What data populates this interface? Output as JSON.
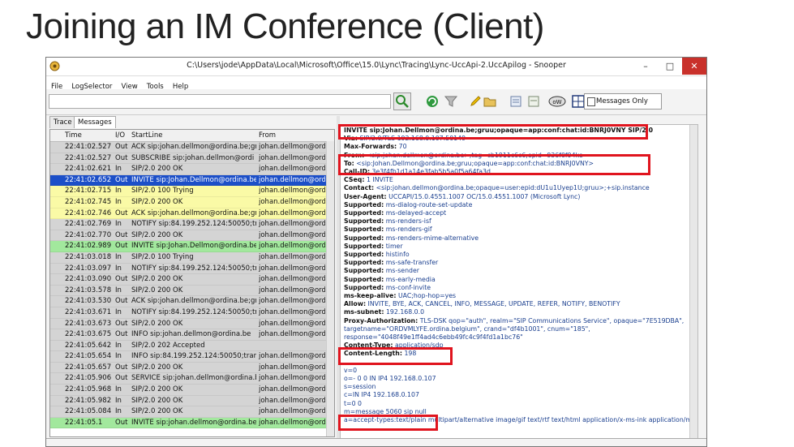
{
  "slide": {
    "title": "Joining an IM Conference (Client)"
  },
  "window": {
    "title": "C:\\Users\\jode\\AppData\\Local\\Microsoft\\Office\\15.0\\Lync\\Tracing\\Lync-UccApi-2.UccApilog - Snooper",
    "minimize": "–",
    "maximize": "□",
    "close": "✕"
  },
  "menu": [
    "File",
    "LogSelector",
    "View",
    "Tools",
    "Help"
  ],
  "toolbar": {
    "filter_value": "",
    "messages_only_label": "Messages Only",
    "messages_only_checked": false
  },
  "tabs": [
    "Trace",
    "Messages"
  ],
  "grid": {
    "columns": [
      "Time",
      "I/O",
      "StartLine",
      "From"
    ],
    "rows": [
      {
        "time": "22:41:02.527",
        "io": "Out",
        "start": "ACK sip:johan.dellmon@ordina.be;gr",
        "from": "johan.dellmon@ordi",
        "style": "gray"
      },
      {
        "time": "22:41:02.527",
        "io": "Out",
        "start": "SUBSCRIBE sip:johan.dellmon@ordi",
        "from": "johan.dellmon@ordi",
        "style": "gray"
      },
      {
        "time": "22:41:02.621",
        "io": "In",
        "start": "SIP/2.0 200 OK",
        "from": "johan.dellmon@ordi",
        "style": "gray"
      },
      {
        "time": "22:41:02.652",
        "io": "Out",
        "start": "INVITE sip:Johan.Dellmon@ordina.be;g",
        "from": "johan.dellmon@ordi",
        "style": "selected"
      },
      {
        "time": "22:41:02.715",
        "io": "In",
        "start": "SIP/2.0 100 Trying",
        "from": "johan.dellmon@ordi",
        "style": "yellow"
      },
      {
        "time": "22:41:02.745",
        "io": "In",
        "start": "SIP/2.0 200 OK",
        "from": "johan.dellmon@ordi",
        "style": "yellow"
      },
      {
        "time": "22:41:02.746",
        "io": "Out",
        "start": "ACK sip:johan.dellmon@ordina.be;gr",
        "from": "johan.dellmon@ordi",
        "style": "yellow"
      },
      {
        "time": "22:41:02.769",
        "io": "In",
        "start": "NOTIFY sip:84.199.252.124:50050;tran",
        "from": "johan.dellmon@ordi",
        "style": "gray"
      },
      {
        "time": "22:41:02.770",
        "io": "Out",
        "start": "SIP/2.0 200 OK",
        "from": "johan.dellmon@ordi",
        "style": "gray"
      },
      {
        "time": "22:41:02.989",
        "io": "Out",
        "start": "INVITE sip:Johan.Dellmon@ordina.be;",
        "from": "johan.dellmon@ordi",
        "style": "green"
      },
      {
        "time": "22:41:03.018",
        "io": "In",
        "start": "SIP/2.0 100 Trying",
        "from": "johan.dellmon@ordi",
        "style": "gray"
      },
      {
        "time": "22:41:03.097",
        "io": "In",
        "start": "NOTIFY sip:84.199.252.124:50050;tran",
        "from": "johan.dellmon@ordi",
        "style": "gray"
      },
      {
        "time": "22:41:03.090",
        "io": "Out",
        "start": "SIP/2.0 200 OK",
        "from": "johan.dellmon@ordi",
        "style": "gray"
      },
      {
        "time": "22:41:03.578",
        "io": "In",
        "start": "SIP/2.0 200 OK",
        "from": "johan.dellmon@ordi",
        "style": "gray"
      },
      {
        "time": "22:41:03.530",
        "io": "Out",
        "start": "ACK sip:johan.dellmon@ordina.be;gr",
        "from": "johan.dellmon@ordi",
        "style": "gray"
      },
      {
        "time": "22:41:03.671",
        "io": "In",
        "start": "NOTIFY sip:84.199.252.124:50050;tran",
        "from": "johan.dellmon@ordi",
        "style": "gray"
      },
      {
        "time": "22:41:03.673",
        "io": "Out",
        "start": "SIP/2.0 200 OK",
        "from": "johan.dellmon@ordi",
        "style": "gray"
      },
      {
        "time": "22:41:03.675",
        "io": "Out",
        "start": "INFO sip:johan.dellmon@ordina.be",
        "from": "johan.dellmon@ordi",
        "style": "gray"
      },
      {
        "time": "22:41:05.642",
        "io": "In",
        "start": "SIP/2.0 202 Accepted",
        "from": "",
        "style": "gray"
      },
      {
        "time": "22:41:05.654",
        "io": "In",
        "start": "INFO sip:84.199.252.124:50050;transpo",
        "from": "johan.dellmon@ordi",
        "style": "gray"
      },
      {
        "time": "22:41:05.657",
        "io": "Out",
        "start": "SIP/2.0 200 OK",
        "from": "johan.dellmon@ordi",
        "style": "gray"
      },
      {
        "time": "22:41:05.906",
        "io": "Out",
        "start": "SERVICE sip:johan.dellmon@ordina.be",
        "from": "johan.dellmon@ordi",
        "style": "gray"
      },
      {
        "time": "22:41:05.968",
        "io": "In",
        "start": "SIP/2.0 200 OK",
        "from": "johan.dellmon@ordi",
        "style": "gray"
      },
      {
        "time": "22:41:05.982",
        "io": "In",
        "start": "SIP/2.0 200 OK",
        "from": "johan.dellmon@ordi",
        "style": "gray"
      },
      {
        "time": "22:41:05.084",
        "io": "In",
        "start": "SIP/2.0 200 OK",
        "from": "johan.dellmon@ordi",
        "style": "gray"
      },
      {
        "time": "22:41:05.1",
        "io": "Out",
        "start": "INVITE sip:johan.dellmon@ordina.be",
        "from": "johan.dellmon@ordi",
        "style": "green"
      }
    ]
  },
  "detail": {
    "lines": [
      {
        "k": "INVITE sip:Johan.Dellmon@ordina.be;gruu;opaque=app:conf:chat:id:BNRJ0VNY SIP/2.0",
        "v": ""
      },
      {
        "k": "Via:",
        "v": "SIP/2.0/TLS 192.168.0.107:50149"
      },
      {
        "k": "Max-Forwards:",
        "v": "70"
      },
      {
        "k": "From:",
        "v": "<sip:johan.dellmon@ordina.be>;tag=cb1911c6c6;epid=936f0f94ke"
      },
      {
        "k": "To:",
        "v": "<sip:Johan.Dellmon@ordina.be;gruu;opaque=app:conf:chat:id:BNRJ0VNY>"
      },
      {
        "k": "Call-ID:",
        "v": "3e3f4fb1d1a14e3fab5b5a0f5a64fa3d"
      },
      {
        "k": "CSeq:",
        "v": "1 INVITE"
      },
      {
        "k": "Contact:",
        "v": "<sip:johan.dellmon@ordina.be;opaque=user:epid:dU1u1Uyep1U;gruu>;+sip.instance"
      },
      {
        "k": "User-Agent:",
        "v": "UCCAPI/15.0.4551.1007 OC/15.0.4551.1007 (Microsoft Lync)"
      },
      {
        "k": "Supported:",
        "v": "ms-dialog-route-set-update"
      },
      {
        "k": "Supported:",
        "v": "ms-delayed-accept"
      },
      {
        "k": "Supported:",
        "v": "ms-renders-isf"
      },
      {
        "k": "Supported:",
        "v": "ms-renders-gif"
      },
      {
        "k": "Supported:",
        "v": "ms-renders-mime-alternative"
      },
      {
        "k": "Supported:",
        "v": "timer"
      },
      {
        "k": "Supported:",
        "v": "histinfo"
      },
      {
        "k": "Supported:",
        "v": "ms-safe-transfer"
      },
      {
        "k": "Supported:",
        "v": "ms-sender"
      },
      {
        "k": "Supported:",
        "v": "ms-early-media"
      },
      {
        "k": "Supported:",
        "v": "ms-conf-invite"
      },
      {
        "k": "ms-keep-alive:",
        "v": "UAC;hop-hop=yes"
      },
      {
        "k": "Allow:",
        "v": "INVITE, BYE, ACK, CANCEL, INFO, MESSAGE, UPDATE, REFER, NOTIFY, BENOTIFY"
      },
      {
        "k": "ms-subnet:",
        "v": "192.168.0.0"
      },
      {
        "k": "Proxy-Authorization:",
        "v": "TLS-DSK qop=\"auth\", realm=\"SIP Communications Service\", opaque=\"7E519DBA\","
      },
      {
        "k": "",
        "v": "targetname=\"ORDVMLYFE.ordina.belgium\", crand=\"df4b1001\", cnum=\"185\","
      },
      {
        "k": "",
        "v": "response=\"4048f49e1ff4ad4c6ebb49fc4c9f4fd1a1bc76\""
      },
      {
        "k": "Content-Type:",
        "v": "application/sdp"
      },
      {
        "k": "Content-Length:",
        "v": "198"
      },
      {
        "k": "",
        "v": ""
      },
      {
        "k": "",
        "v": "v=0"
      },
      {
        "k": "",
        "v": "o=- 0 0 IN IP4 192.168.0.107"
      },
      {
        "k": "",
        "v": "s=session"
      },
      {
        "k": "",
        "v": "c=IN IP4 192.168.0.107"
      },
      {
        "k": "",
        "v": "t=0 0"
      },
      {
        "k": "",
        "v": "m=message 5060 sip null"
      },
      {
        "k": "",
        "v": "a=accept-types:text/plain multipart/alternative image/gif text/rtf text/html application/x-ms-ink application/ms-"
      }
    ]
  },
  "colors": {
    "highlight": "#e0141e",
    "selected_row": "#1c4fc8",
    "yellow_row": "#fafaa6",
    "green_row": "#a2e89d",
    "gray_row": "#d4d4d4"
  }
}
